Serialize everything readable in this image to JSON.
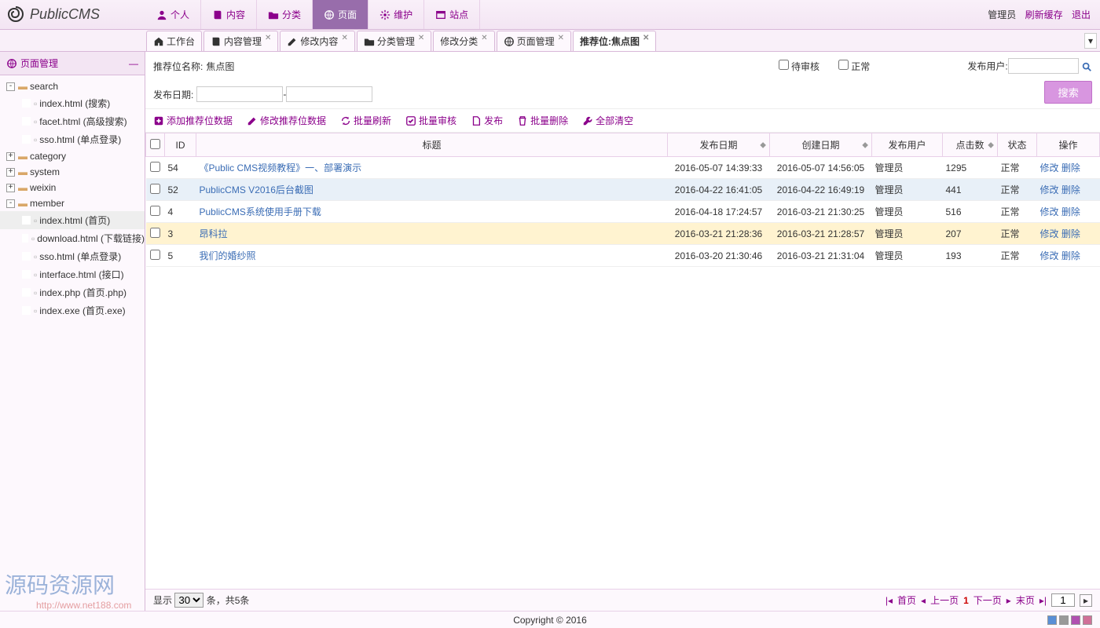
{
  "brand": "PublicCMS",
  "topnav": [
    {
      "icon": "user",
      "label": "个人"
    },
    {
      "icon": "book",
      "label": "内容"
    },
    {
      "icon": "folder",
      "label": "分类"
    },
    {
      "icon": "globe",
      "label": "页面",
      "active": true
    },
    {
      "icon": "gear",
      "label": "维护"
    },
    {
      "icon": "site",
      "label": "站点"
    }
  ],
  "toplinks": {
    "admin": "管理员",
    "refresh": "刷新缓存",
    "logout": "退出"
  },
  "tabs": [
    {
      "icon": "home",
      "label": "工作台"
    },
    {
      "icon": "book",
      "label": "内容管理",
      "close": true
    },
    {
      "icon": "edit",
      "label": "修改内容",
      "close": true
    },
    {
      "icon": "folder",
      "label": "分类管理",
      "close": true
    },
    {
      "icon": "",
      "label": "修改分类",
      "close": true
    },
    {
      "icon": "globe",
      "label": "页面管理",
      "close": true
    },
    {
      "icon": "",
      "label": "推荐位:焦点图",
      "close": true,
      "active": true
    }
  ],
  "sidebar": {
    "title": "页面管理",
    "tree": [
      {
        "lvl": 1,
        "tog": "-",
        "type": "folder-open",
        "label": "search"
      },
      {
        "lvl": 2,
        "tog": "",
        "type": "file",
        "label": "index.html (搜索)"
      },
      {
        "lvl": 2,
        "tog": "",
        "type": "file",
        "label": "facet.html (高级搜索)"
      },
      {
        "lvl": 2,
        "tog": "",
        "type": "file",
        "label": "sso.html (单点登录)"
      },
      {
        "lvl": 1,
        "tog": "+",
        "type": "folder",
        "label": "category"
      },
      {
        "lvl": 1,
        "tog": "+",
        "type": "folder",
        "label": "system"
      },
      {
        "lvl": 1,
        "tog": "+",
        "type": "folder",
        "label": "weixin"
      },
      {
        "lvl": 1,
        "tog": "-",
        "type": "folder-open",
        "label": "member"
      },
      {
        "lvl": 2,
        "tog": "",
        "type": "file",
        "label": "index.html (首页)",
        "sel": true
      },
      {
        "lvl": 2,
        "tog": "",
        "type": "file",
        "label": "download.html (下载链接)"
      },
      {
        "lvl": 2,
        "tog": "",
        "type": "file",
        "label": "sso.html (单点登录)"
      },
      {
        "lvl": 2,
        "tog": "",
        "type": "file",
        "label": "interface.html (接口)"
      },
      {
        "lvl": 2,
        "tog": "",
        "type": "file",
        "label": "index.php (首页.php)"
      },
      {
        "lvl": 2,
        "tog": "",
        "type": "file",
        "label": "index.exe (首页.exe)"
      }
    ]
  },
  "filters": {
    "name_label": "推荐位名称:",
    "name_value": "焦点图",
    "date_label": "发布日期:",
    "date_sep": "-",
    "pending_label": "待审核",
    "normal_label": "正常",
    "publisher_label": "发布用户:",
    "search_btn": "搜索"
  },
  "toolbar": [
    {
      "icon": "plus",
      "label": "添加推荐位数据"
    },
    {
      "icon": "edit",
      "label": "修改推荐位数据"
    },
    {
      "icon": "refresh",
      "label": "批量刷新"
    },
    {
      "icon": "check",
      "label": "批量审核"
    },
    {
      "icon": "file",
      "label": "发布"
    },
    {
      "icon": "trash",
      "label": "批量删除"
    },
    {
      "icon": "wrench",
      "label": "全部清空"
    }
  ],
  "columns": [
    "",
    "ID",
    "标题",
    "发布日期",
    "创建日期",
    "发布用户",
    "点击数",
    "状态",
    "操作"
  ],
  "rows": [
    {
      "id": "54",
      "title": "《Public CMS视频教程》一、部署演示",
      "pub": "2016-05-07 14:39:33",
      "create": "2016-05-07 14:56:05",
      "user": "管理员",
      "clicks": "1295",
      "status": "正常",
      "cls": ""
    },
    {
      "id": "52",
      "title": "PublicCMS V2016后台截图",
      "pub": "2016-04-22 16:41:05",
      "create": "2016-04-22 16:49:19",
      "user": "管理员",
      "clicks": "441",
      "status": "正常",
      "cls": "blue"
    },
    {
      "id": "4",
      "title": "PublicCMS系统使用手册下载",
      "pub": "2016-04-18 17:24:57",
      "create": "2016-03-21 21:30:25",
      "user": "管理员",
      "clicks": "516",
      "status": "正常",
      "cls": ""
    },
    {
      "id": "3",
      "title": "昂科拉",
      "pub": "2016-03-21 21:28:36",
      "create": "2016-03-21 21:28:57",
      "user": "管理员",
      "clicks": "207",
      "status": "正常",
      "cls": "hl"
    },
    {
      "id": "5",
      "title": "我们的婚纱照",
      "pub": "2016-03-20 21:30:46",
      "create": "2016-03-21 21:31:04",
      "user": "管理员",
      "clicks": "193",
      "status": "正常",
      "cls": ""
    }
  ],
  "actions": {
    "edit": "修改",
    "del": "删除"
  },
  "pager": {
    "show_label": "显示",
    "per_page": "30",
    "count_text": "条，共5条",
    "first": "首页",
    "prev": "上一页",
    "cur": "1",
    "next": "下一页",
    "last": "末页",
    "goto": "1"
  },
  "footer": "Copyright © 2016",
  "swatches": [
    "#5a8fd6",
    "#999",
    "#b050b0",
    "#d07098"
  ],
  "watermark": {
    "text": "源码资源网",
    "url": "http://www.net188.com"
  }
}
